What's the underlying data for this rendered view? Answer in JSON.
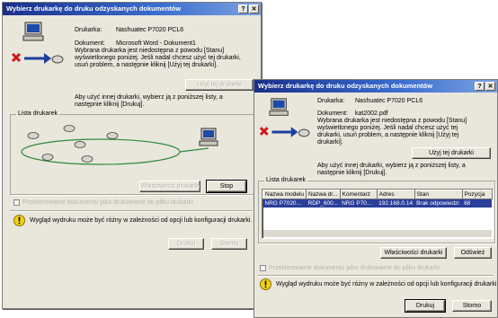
{
  "back_dialog": {
    "title": "Wybierz drukarkę do druku odzyskanych dokumentów",
    "title_buttons": [
      "?",
      "✕"
    ],
    "printer_label": "Drukarka:",
    "printer_value": "Nashuatec P7020 PCL6",
    "document_label": "Dokument:",
    "document_value": "Microsoft Word - Dokument1",
    "info_text": "Wybrana drukarka jest niedostępna z powodu [Stanu] wyświetlonego poniżej. Jeśli nadal chcesz użyć tej drukarki, usuń problem, a następnie kliknij [Użyj tej drukarki].",
    "use_printer_button": "Użyj tej drukarki",
    "other_printer_text": "Aby użyć innej drukarki, wybierz ją z poniższej listy, a następnie kliknij [Drukuj].",
    "printer_list_title": "Lista drukarek",
    "printer_properties_button": "Właściwości drukarki",
    "stop_button": "Stop",
    "checkbox_label": "Przekierowanie dokumentu jako drukowanie do pliku drukarki",
    "warning_text": "Wygląd wydruku może być różny w zależności od opcji lub konfiguracji drukarki.",
    "print_button": "Drukuj",
    "cancel_button": "Storno"
  },
  "front_dialog": {
    "title": "Wybierz drukarkę do druku odzyskanych dokumentów",
    "title_buttons": [
      "?",
      "✕"
    ],
    "printer_label": "Drukarka:",
    "printer_value": "Nashuatec P7020 PCL6",
    "document_label": "Dokument:",
    "document_value": "kat2002.pdf",
    "info_text": "Wybrana drukarka jest niedostępna z powodu [Stanu] wyświetlonego poniżej. Jeśli nadal chcesz użyć tej drukarki, usuń problem, a następnie kliknij [Użyj tej drukarki].",
    "use_printer_button": "Użyj tej drukarki",
    "other_printer_text": "Aby użyć innej drukarki, wybierz ją z poniższej listy, a następnie kliknij [Drukuj].",
    "printer_list_title": "Lista drukarek",
    "columns": [
      "Nazwa modelu",
      "Nazwa dr...",
      "Komentarz",
      "Adres",
      "Stan",
      "Pozycja"
    ],
    "rows": [
      [
        "NRG P7020...",
        "RDP_600...",
        "NRG P70...",
        "192.168.0.14",
        "Brak odpowiedzi",
        "88"
      ]
    ],
    "printer_properties_button": "Właściwości drukarki",
    "refresh_button": "Odśwież",
    "checkbox_label": "Przekierowanie dokumentu jako drukowanie do pliku drukarki",
    "warning_text": "Wygląd wydruku może być różny w zależności od opcji lub konfiguracji drukarki.",
    "print_button": "Drukuj",
    "cancel_button": "Storno"
  }
}
